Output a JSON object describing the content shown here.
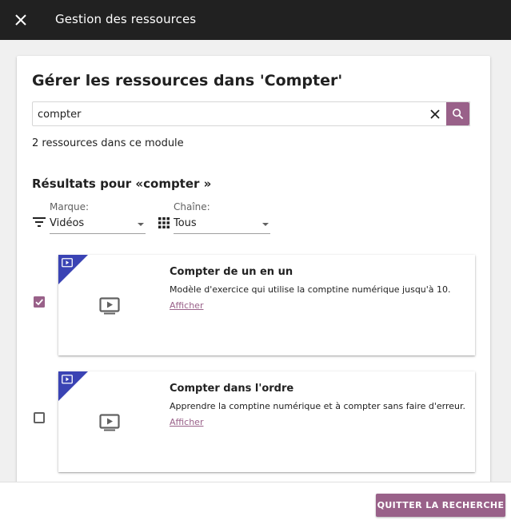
{
  "appbar": {
    "title": "Gestion des ressources"
  },
  "page": {
    "heading": "Gérer les ressources dans 'Compter'",
    "count_text": "2 ressources dans ce module",
    "results_heading": "Résultats pour «compter »"
  },
  "search": {
    "value": "compter",
    "placeholder": ""
  },
  "filters": {
    "brand": {
      "label": "Marque:",
      "value": "Vidéos"
    },
    "channel": {
      "label": "Chaîne:",
      "value": "Tous"
    }
  },
  "results": [
    {
      "title": "Compter de un en un",
      "description": "Modèle d'exercice qui utilise la comptine numérique jusqu'à 10.",
      "link": "Afficher",
      "checked": true
    },
    {
      "title": "Compter dans l'ordre",
      "description": "Apprendre la comptine numérique et à compter sans faire d'erreur.",
      "link": "Afficher",
      "checked": false
    }
  ],
  "bottom": {
    "quit_label": "QUITTER LA RECHERCHE"
  },
  "colors": {
    "accent": "#996189",
    "corner": "#3a43b4",
    "appbar": "#212121"
  },
  "icons": {
    "close": "close-icon",
    "clear": "clear-icon",
    "search": "search-icon",
    "filter": "filter-icon",
    "grid": "apps-grid-icon",
    "video": "video-icon",
    "checkbox_checked": "checkbox-checked-icon",
    "checkbox_unchecked": "checkbox-unchecked-icon"
  }
}
